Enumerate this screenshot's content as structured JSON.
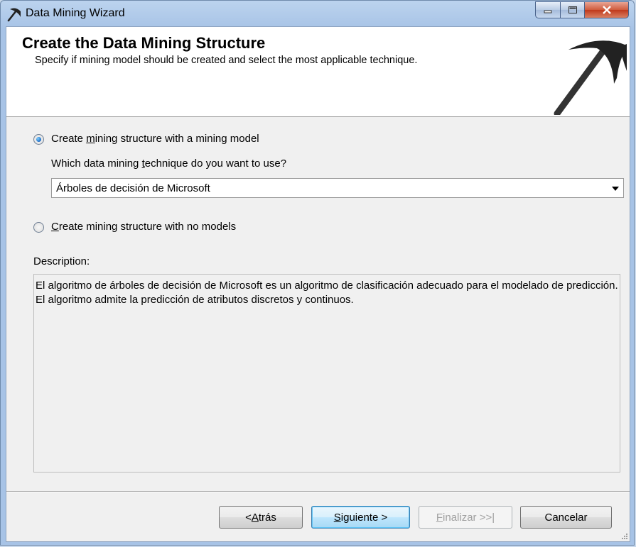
{
  "window": {
    "title": "Data Mining Wizard",
    "icon": "pickaxe-icon",
    "caption_buttons": [
      "minimize",
      "maximize",
      "close"
    ]
  },
  "header": {
    "title": "Create the Data Mining Structure",
    "subtitle": "Specify if mining model should be created and select the most applicable technique.",
    "logo": "pickaxe-logo"
  },
  "options": {
    "with_model": {
      "label_pre": "Create ",
      "label_accel": "m",
      "label_post": "ining structure with a mining  model",
      "checked": true
    },
    "technique_prompt_pre": "Which data mining ",
    "technique_prompt_accel": "t",
    "technique_prompt_post": "echnique do you want to use?",
    "technique_selected": "Árboles de decisión de Microsoft",
    "no_models": {
      "label_accel": "C",
      "label_post": "reate mining structure with no models",
      "checked": false
    }
  },
  "description": {
    "label": "Description:",
    "text": "El algoritmo de árboles de decisión de Microsoft es un algoritmo de clasificación adecuado para el modelado de predicción. El algoritmo admite la predicción de atributos discretos y continuos."
  },
  "buttons": {
    "back_pre": "< ",
    "back_accel": "A",
    "back_post": "trás",
    "next_accel": "S",
    "next_post": "iguiente >",
    "finish_accel": "F",
    "finish_post": "inalizar >>|",
    "cancel": "Cancelar"
  },
  "colors": {
    "accent_radio": "#1d6bc5",
    "close_button": "#c0391c",
    "client_bg": "#f0f0f0"
  }
}
